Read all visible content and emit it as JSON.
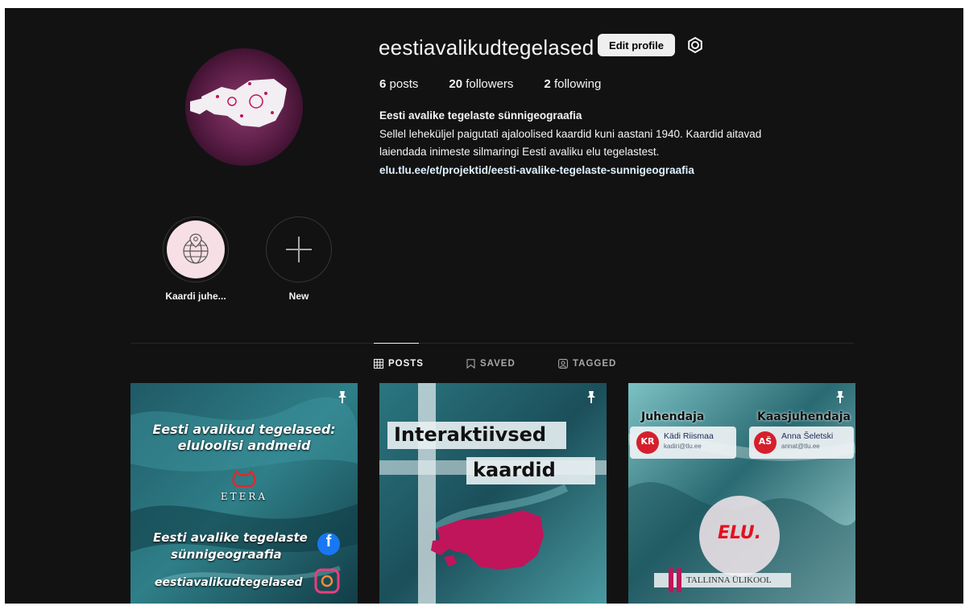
{
  "profile": {
    "username": "eestiavalikudtegelased",
    "edit_label": "Edit profile",
    "settings_icon": "gear-icon"
  },
  "stats": {
    "posts_count": "6",
    "posts_label": "posts",
    "followers_count": "20",
    "followers_label": "followers",
    "following_count": "2",
    "following_label": "following"
  },
  "bio": {
    "name": "Eesti avalike tegelaste sünnigeograafia",
    "line1": "Sellel leheküljel paigutati ajaloolised kaardid kuni aastani 1940. Kaardid aitavad",
    "line2": "laiendada inimeste silmaringi Eesti avaliku elu tegelastest.",
    "link": "elu.tlu.ee/et/projektid/eesti-avalike-tegelaste-sunnigeograafia"
  },
  "highlights": [
    {
      "label": "Kaardi juhe..."
    },
    {
      "label": "New"
    }
  ],
  "tabs": [
    {
      "label": "POSTS",
      "active": true
    },
    {
      "label": "SAVED",
      "active": false
    },
    {
      "label": "TAGGED",
      "active": false
    }
  ],
  "posts": [
    {
      "title_line1": "Eesti avalikud tegelased:",
      "title_line2": "eluloolisi andmeid",
      "logo_text": "ETERA",
      "mid_line1": "Eesti avalike tegelaste",
      "mid_line2": "sünnigeograafia",
      "handle": "eestiavalikudtegelased"
    },
    {
      "line1": "Interaktiivsed",
      "line2": "kaardid"
    },
    {
      "left_heading": "Juhendaja",
      "right_heading": "Kaasjuhendaja",
      "left_initials": "KR",
      "left_name": "Kädi Riismaa",
      "left_email": "kadiri@tlu.ee",
      "right_initials": "AŠ",
      "right_name": "Anna Šeletski",
      "right_email": "annat@tlu.ee",
      "badge_text": "ELU.",
      "footer": "TALLINNA ÜLIKOOL"
    }
  ],
  "colors": {
    "background": "#121212",
    "text": "#f5f5f5",
    "muted": "#a8a8a8",
    "link": "#e0f1ff",
    "map_magenta": "#c0155a"
  }
}
